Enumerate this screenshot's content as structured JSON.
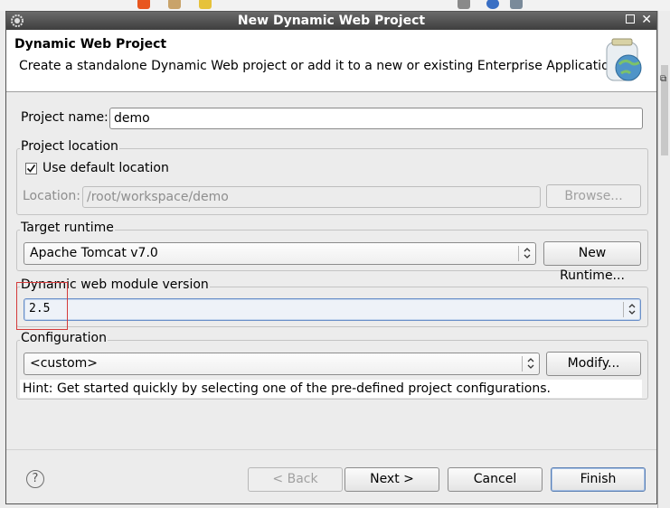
{
  "window": {
    "title": "New Dynamic Web Project"
  },
  "header": {
    "title": "Dynamic Web Project",
    "description": "Create a standalone Dynamic Web project or add it to a new or existing Enterprise Application."
  },
  "project_name": {
    "label": "Project name:",
    "value": "demo"
  },
  "project_location": {
    "group_label": "Project location",
    "use_default_label": "Use default location",
    "use_default_checked": true,
    "location_label": "Location:",
    "location_value": "/root/workspace/demo",
    "browse_label": "Browse..."
  },
  "target_runtime": {
    "group_label": "Target runtime",
    "selected": "Apache Tomcat v7.0",
    "new_runtime_label": "New Runtime..."
  },
  "module_version": {
    "group_label": "Dynamic web module version",
    "selected": "2.5"
  },
  "configuration": {
    "group_label": "Configuration",
    "selected": "<custom>",
    "modify_label": "Modify...",
    "hint": "Hint: Get started quickly by selecting one of the pre-defined project configurations."
  },
  "footer": {
    "help_glyph": "?",
    "back_label": "< Back",
    "next_label": "Next >",
    "cancel_label": "Cancel",
    "finish_label": "Finish"
  },
  "icons": {
    "app": "eclipse-gear-icon",
    "header": "globe-jar-icon",
    "help": "help-icon",
    "close": "close-icon",
    "maximize": "maximize-icon"
  },
  "colors": {
    "titlebar": "#4a4a4a",
    "highlight": "#d43b3b",
    "primary_border": "#5a7fb3"
  }
}
